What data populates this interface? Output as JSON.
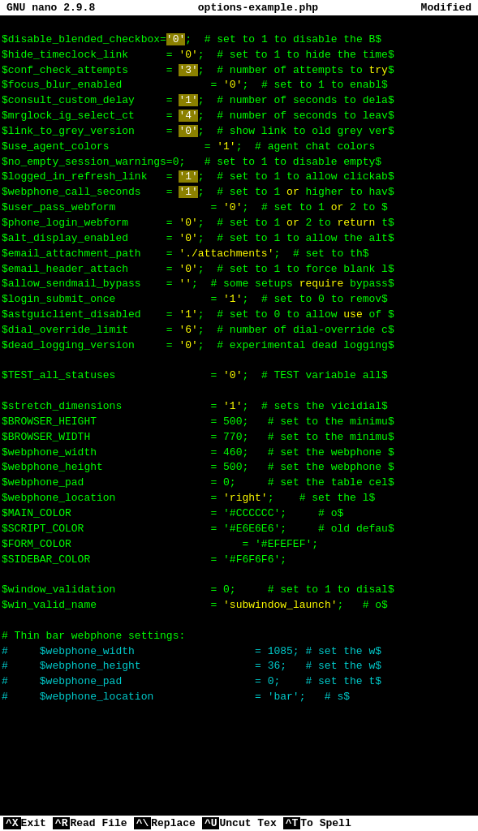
{
  "titleBar": {
    "left": "GNU nano 2.9.8",
    "center": "options-example.php",
    "right": "Modified"
  },
  "lines": [
    {
      "id": 1,
      "content": "$disable_blended_checkbox='0';  # set to 1 to disable the B$"
    },
    {
      "id": 2,
      "content": "$hide_timeclock_link      = '0';  # set to 1 to hide the time$"
    },
    {
      "id": 3,
      "content": "$conf_check_attempts      = '3';  # number of attempts to try$"
    },
    {
      "id": 4,
      "content": "$focus_blur_enabled              = '0';  # set to 1 to enabl$"
    },
    {
      "id": 5,
      "content": "$consult_custom_delay     = '1';  # number of seconds to dela$"
    },
    {
      "id": 6,
      "content": "$mrglock_ig_select_ct     = '4';  # number of seconds to leav$"
    },
    {
      "id": 7,
      "content": "$link_to_grey_version     = '0';  # show link to old grey ver$"
    },
    {
      "id": 8,
      "content": "$use_agent_colors               = '1';  # agent chat colors  "
    },
    {
      "id": 9,
      "content": "$no_empty_session_warnings=0;   # set to 1 to disable empty$"
    },
    {
      "id": 10,
      "content": "$logged_in_refresh_link   = '1';  # set to 1 to allow clickab$"
    },
    {
      "id": 11,
      "content": "$webphone_call_seconds    = '1';  # set to 1 or higher to hav$"
    },
    {
      "id": 12,
      "content": "$user_pass_webform               = '0';  # set to 1 or 2 to $"
    },
    {
      "id": 13,
      "content": "$phone_login_webform      = '0';  # set to 1 or 2 to return t$"
    },
    {
      "id": 14,
      "content": "$alt_display_enabled      = '0';  # set to 1 to allow the alt$"
    },
    {
      "id": 15,
      "content": "$email_attachment_path    = './attachments';  # set to th$"
    },
    {
      "id": 16,
      "content": "$email_header_attach      = '0';  # set to 1 to force blank l$"
    },
    {
      "id": 17,
      "content": "$allow_sendmail_bypass    = '';  # some setups require bypass$"
    },
    {
      "id": 18,
      "content": "$login_submit_once               = '1';  # set to 0 to remov$"
    },
    {
      "id": 19,
      "content": "$astguiclient_disabled    = '1';  # set to 0 to allow use of $"
    },
    {
      "id": 20,
      "content": "$dial_override_limit      = '6';  # number of dial-override c$"
    },
    {
      "id": 21,
      "content": "$dead_logging_version     = '0';  # experimental dead logging$"
    },
    {
      "id": 22,
      "content": ""
    },
    {
      "id": 23,
      "content": "$TEST_all_statuses               = '0';  # TEST variable all$"
    },
    {
      "id": 24,
      "content": ""
    },
    {
      "id": 25,
      "content": "$stretch_dimensions              = '1';  # sets the vicidial$"
    },
    {
      "id": 26,
      "content": "$BROWSER_HEIGHT                  = 500;   # set to the minimu$"
    },
    {
      "id": 27,
      "content": "$BROWSER_WIDTH                   = 770;   # set to the minimu$"
    },
    {
      "id": 28,
      "content": "$webphone_width                  = 460;   # set the webphone $"
    },
    {
      "id": 29,
      "content": "$webphone_height                 = 500;   # set the webphone $"
    },
    {
      "id": 30,
      "content": "$webphone_pad                    = 0;     # set the table cel$"
    },
    {
      "id": 31,
      "content": "$webphone_location               = 'right';    # set the l$"
    },
    {
      "id": 32,
      "content": "$MAIN_COLOR                      = '#CCCCCC';     # o$"
    },
    {
      "id": 33,
      "content": "$SCRIPT_COLOR                    = '#E6E6E6';     # old defau$"
    },
    {
      "id": 34,
      "content": "$FORM_COLOR                           = '#EFEFEF';"
    },
    {
      "id": 35,
      "content": "$SIDEBAR_COLOR                   = '#F6F6F6';"
    },
    {
      "id": 36,
      "content": ""
    },
    {
      "id": 37,
      "content": "$window_validation               = 0;     # set to 1 to disal$"
    },
    {
      "id": 38,
      "content": "$win_valid_name                  = 'subwindow_launch';   # o$"
    },
    {
      "id": 39,
      "content": ""
    },
    {
      "id": 40,
      "content": "# Thin bar webphone settings:"
    },
    {
      "id": 41,
      "content": "#     $webphone_width                   = 1085; # set the w$"
    },
    {
      "id": 42,
      "content": "#     $webphone_height                  = 36;   # set the w$"
    },
    {
      "id": 43,
      "content": "#     $webphone_pad                     = 0;    # set the t$"
    },
    {
      "id": 44,
      "content": "#     $webphone_location                = 'bar';   # s$"
    }
  ],
  "bottomBar": {
    "items": [
      {
        "key": "^X",
        "label": "Exit"
      },
      {
        "key": "^R",
        "label": "Read File"
      },
      {
        "key": "^\\",
        "label": "Replace"
      },
      {
        "key": "^U",
        "label": "Uncut Tex"
      },
      {
        "key": "^T",
        "label": "To Spell"
      }
    ]
  }
}
